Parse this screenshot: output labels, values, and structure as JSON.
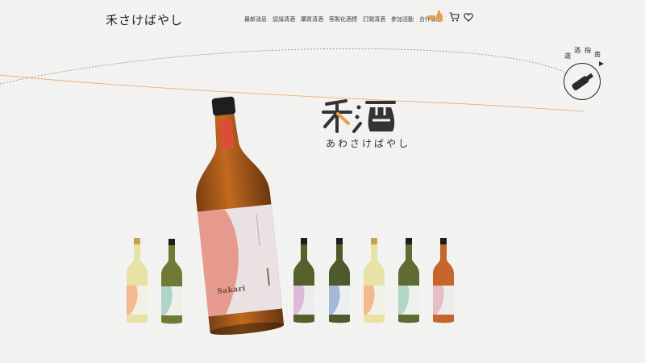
{
  "brand": {
    "name": "禾さけばやし"
  },
  "nav": {
    "items": [
      "最新消息",
      "認識清酒",
      "購買清酒",
      "客製化酒標",
      "訂閱清酒",
      "參加活動",
      "合作餐廳"
    ]
  },
  "header_icons": [
    "sake-set-icon",
    "cart-icon",
    "heart-icon"
  ],
  "guide": {
    "chars": [
      "選",
      "酒",
      "指",
      "南"
    ]
  },
  "hero": {
    "logo": "禾酒",
    "subtitle": "あわさけばやし"
  },
  "featured_bottle": {
    "label": "Sakari"
  },
  "colors": {
    "background": "#f4f4f2",
    "accent_orange": "#e8a14a",
    "ink": "#2b2b2b"
  },
  "product_lineup": [
    {
      "liquid": "#e9e2a6",
      "label_accent": "#f1b07c"
    },
    {
      "liquid": "#6f7a37",
      "label_accent": "#a6cfc4"
    },
    {
      "liquid": "#56602a",
      "label_accent": "#d8b6d6"
    },
    {
      "liquid": "#4e5a2b",
      "label_accent": "#9ab3d6"
    },
    {
      "liquid": "#e9e2a6",
      "label_accent": "#f1b07c"
    },
    {
      "liquid": "#5f6b33",
      "label_accent": "#a9d4c2"
    },
    {
      "liquid": "#c7652a",
      "label_accent": "#e6b9c4"
    }
  ]
}
